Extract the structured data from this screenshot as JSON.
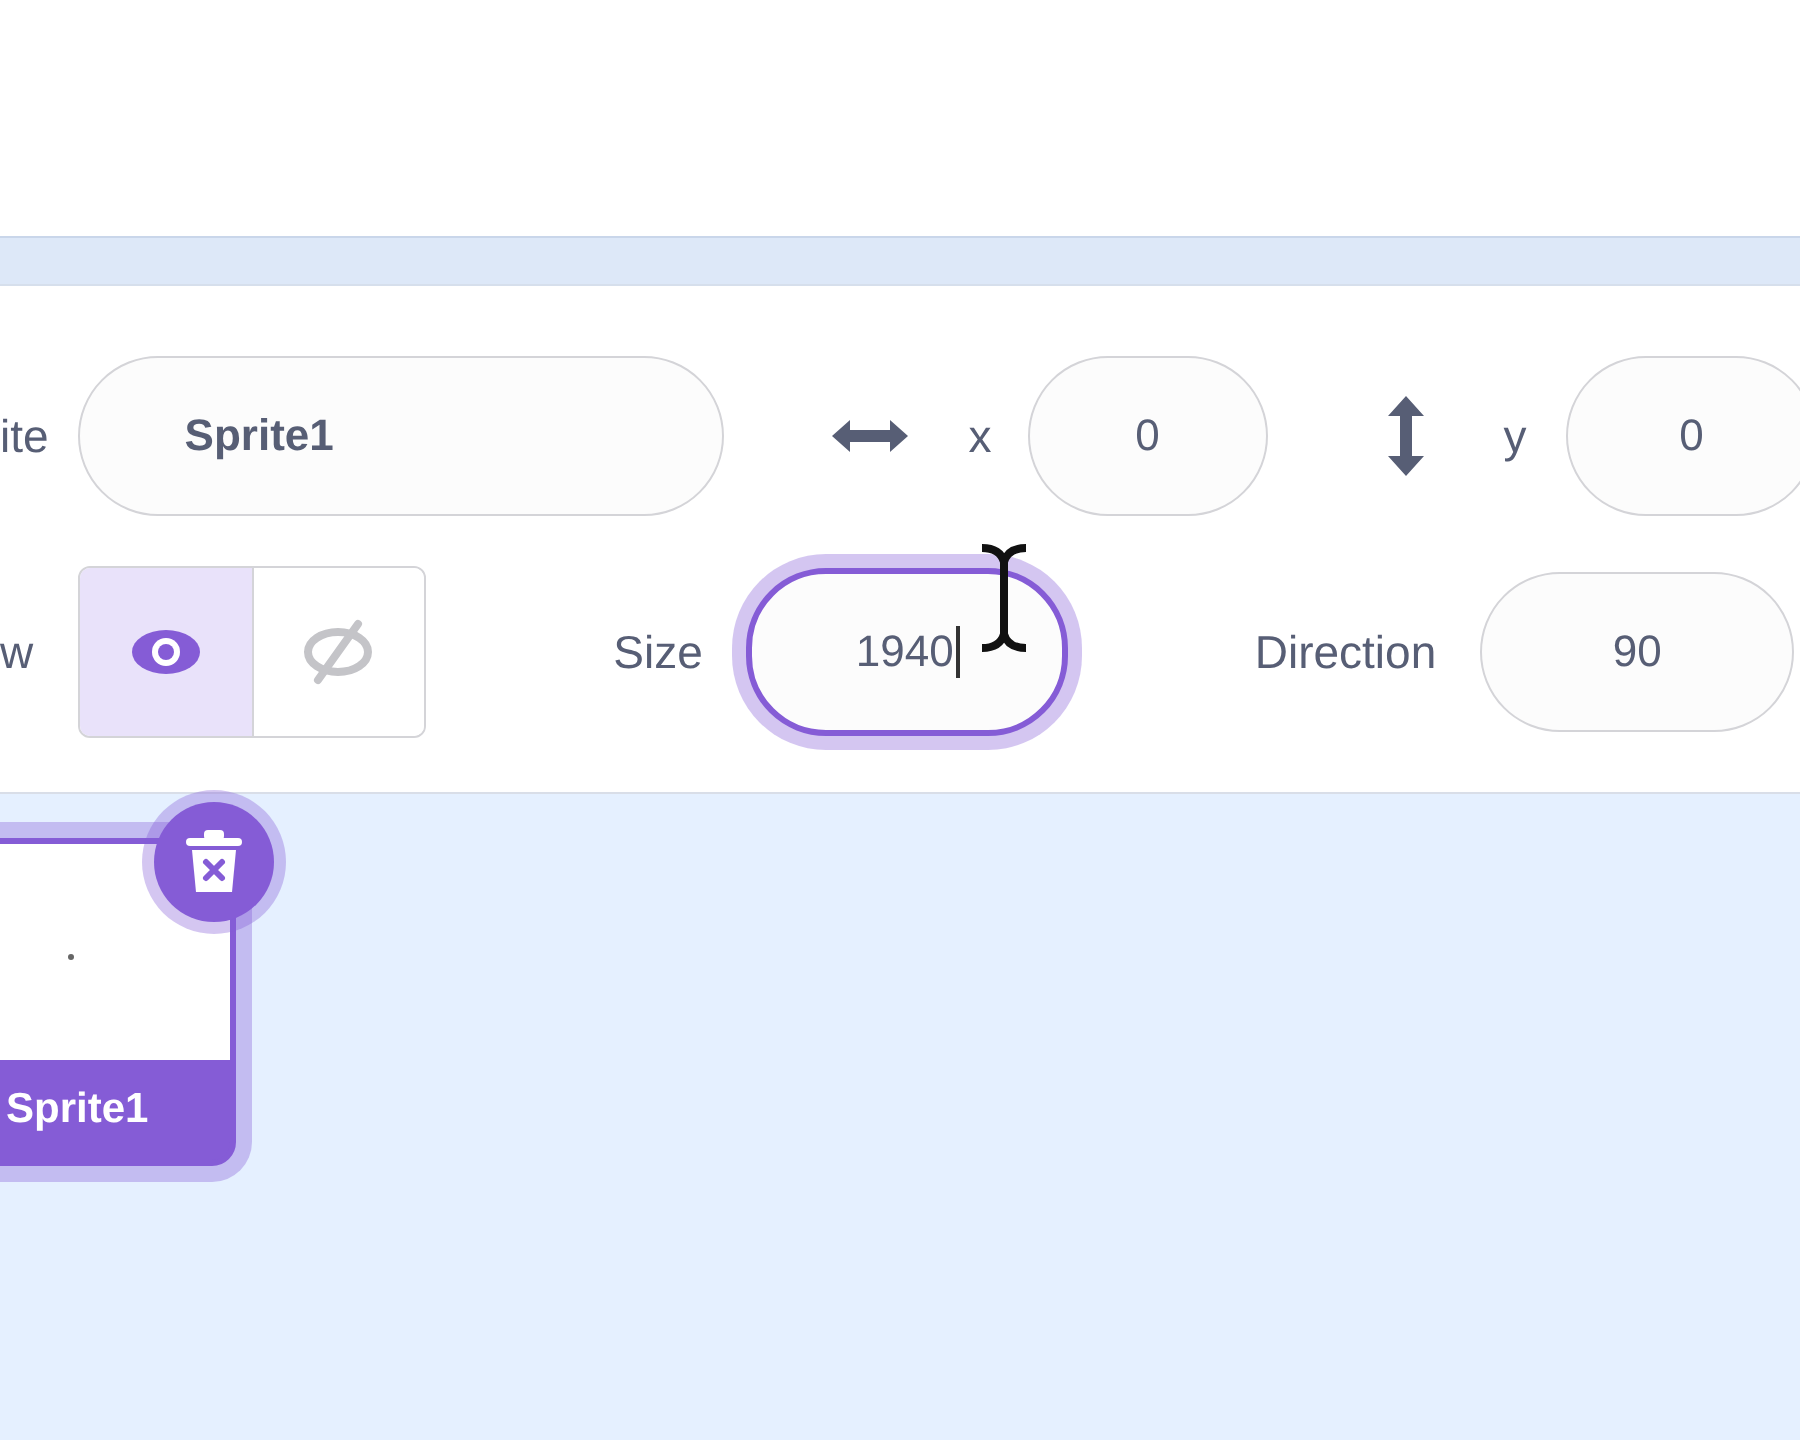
{
  "sprite_info": {
    "name_label": "ite",
    "name_value": "Sprite1",
    "x_label": "x",
    "x_value": "0",
    "y_label": "y",
    "y_value": "0",
    "show_label": "w",
    "visibility": [
      {
        "kind": "show",
        "selected": true
      },
      {
        "kind": "hide",
        "selected": false
      }
    ],
    "size_label": "Size",
    "size_value": "1940",
    "size_focused": true,
    "direction_label": "Direction",
    "direction_value": "90"
  },
  "sprites": [
    {
      "name": "Sprite1",
      "selected": true
    }
  ]
}
